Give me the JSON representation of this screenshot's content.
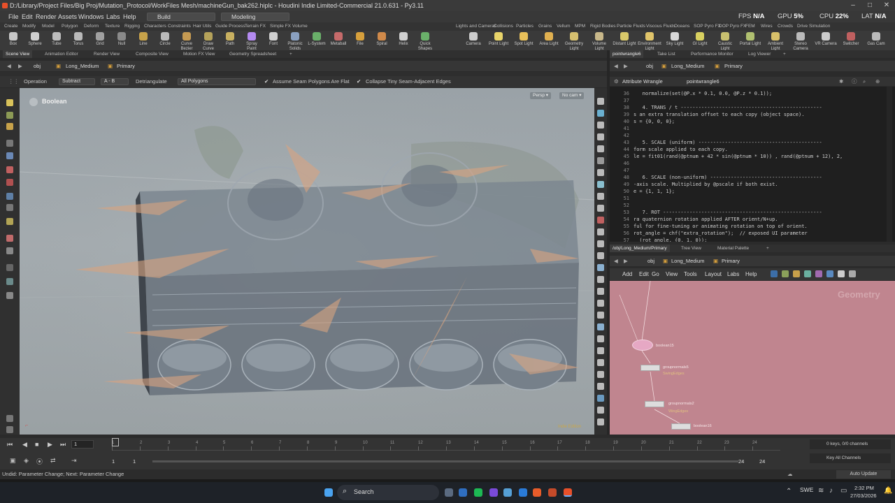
{
  "window": {
    "title": "D:/Library/Project Files/Big Proj/Mutation_Protocol/WorkFiles Mesh/machineGun_bak262.hiplc - Houdini Indie Limited-Commercial 21.0.631 - Py3.11"
  },
  "menubar": {
    "items": [
      "File",
      "Edit",
      "Render",
      "Assets",
      "Windows",
      "Labs",
      "Help"
    ],
    "desktop_build": "Build",
    "desktop_modeling": "Modeling",
    "fps_label": "FPS",
    "fps_value": "N/A",
    "gpu_label": "GPU",
    "gpu_value": "5%",
    "cpu_label": "CPU",
    "cpu_value": "22%",
    "lat_label": "LAT",
    "lat_value": "N/A"
  },
  "shelf": {
    "tabs_left": [
      "Create",
      "Modify",
      "Model",
      "Polygon",
      "Deform",
      "Texture",
      "Rigging",
      "Characters",
      "Constraints",
      "Hair Utils",
      "Guide Process",
      "Terrain FX",
      "Simple FX",
      "Volume"
    ],
    "tabs_right": [
      "Lights and Cameras",
      "Collisions",
      "Particles",
      "Grains",
      "Vellum",
      "MPM",
      "Rigid Bodies",
      "Particle Fluids",
      "Viscous Fluids",
      "Oceans",
      "SOP Pyro FX",
      "DOP Pyro FX",
      "FEM",
      "Wires",
      "Crowds",
      "Drive Simulation"
    ],
    "tools_left": [
      "Box",
      "Sphere",
      "Tube",
      "Torus",
      "Grid",
      "Null",
      "Line",
      "Circle",
      "Curve Bezier",
      "Draw Curve",
      "Path",
      "Spray Paint",
      "Font",
      "Platonic Solids",
      "L-System",
      "Metaball",
      "File",
      "Spiral",
      "Helix",
      "Quick Shapes"
    ],
    "tools_right": [
      "Camera",
      "Point Light",
      "Spot Light",
      "Area Light",
      "Geometry Light",
      "Volume Light",
      "Distant Light",
      "Environment Light",
      "Sky Light",
      "GI Light",
      "Caustic Light",
      "Portal Light",
      "Ambient Light",
      "Stereo Camera",
      "VR Camera",
      "Switcher",
      "Gas Cam"
    ]
  },
  "left_pane": {
    "tabs": [
      "Scene View",
      "Animation Editor",
      "Render View",
      "Composite View",
      "Motion FX View",
      "Geometry Spreadsheet"
    ],
    "path": [
      "obj",
      "Long_Medium",
      "Primary"
    ],
    "operation_label": "Operation",
    "operation_value": "Subtract",
    "ab_value": "A - B",
    "detriangulate_label": "Detriangulate",
    "detriangulate_value": "All Polygons",
    "assume_seam_label": "Assume Seam Polygons Are Flat",
    "collapse_label": "Collapse Tiny Seam-Adjacent Edges",
    "viewport_node": "Boolean",
    "persp_label": "Persp",
    "cam_label": "No cam",
    "scale_label": "Indie Edition"
  },
  "right_top": {
    "tabs": [
      "pointwrangle6",
      "Take List",
      "Performance Monitor",
      "Log Viewer"
    ],
    "path": [
      "obj",
      "Long_Medium",
      "Primary"
    ],
    "param_title": "Attribute Wrangle",
    "node_name": "pointwrangle6",
    "code_lines": [
      {
        "n": "36",
        "t": "   normalize(set(@P.x * 0.1, 0.0, @P.z * 0.1));"
      },
      {
        "n": "37",
        "t": ""
      },
      {
        "n": "38",
        "t": "   4. TRANS / t ------------------------------------------------"
      },
      {
        "n": "39",
        "t": "s an extra translation offset to each copy (object space)."
      },
      {
        "n": "40",
        "t": "s = {0, 0, 0};"
      },
      {
        "n": "41",
        "t": ""
      },
      {
        "n": "42",
        "t": ""
      },
      {
        "n": "43",
        "t": "   5. SCALE (uniform) ------------------------------------------"
      },
      {
        "n": "44",
        "t": "form scale applied to each copy."
      },
      {
        "n": "45",
        "t": "le = fit01(rand(@ptnum + 42 * sin(@ptnum * 10)) , rand(@ptnum + 12), 2,"
      },
      {
        "n": "46",
        "t": ""
      },
      {
        "n": "47",
        "t": ""
      },
      {
        "n": "48",
        "t": "   6. SCALE (non-uniform) --------------------------------------"
      },
      {
        "n": "49",
        "t": "-axis scale. Multiplied by @pscale if both exist."
      },
      {
        "n": "50",
        "t": "e = {1, 1, 1};"
      },
      {
        "n": "51",
        "t": ""
      },
      {
        "n": "52",
        "t": ""
      },
      {
        "n": "53",
        "t": "   7. ROT ------------------------------------------------------"
      },
      {
        "n": "54",
        "t": "ra quaternion rotation applied AFTER orient/N+up."
      },
      {
        "n": "55",
        "t": "ful for fine-tuning or animating rotation on top of orient."
      },
      {
        "n": "56",
        "t": "rot_angle = chf(\"extra_rotation\");  // exposed UI parameter"
      },
      {
        "n": "57",
        "t": "  (rot_angle, {0, 1, 0});"
      }
    ]
  },
  "right_bottom": {
    "tabs": [
      "/obj/Long_Medium/Primary",
      "Tree View",
      "Material Palette"
    ],
    "path": [
      "obj",
      "Long_Medium",
      "Primary"
    ],
    "menu": [
      "Add",
      "Edit",
      "Go",
      "View",
      "Tools",
      "Layout",
      "Labs",
      "Help"
    ],
    "context_label": "Geometry",
    "nodes": [
      "boolean15",
      "groupnormals5",
      "groupnormals2",
      "boolean16"
    ],
    "node_sublabels": [
      "",
      "SwingEdges",
      "",
      "WingEdges"
    ]
  },
  "timeline": {
    "current_frame": "1",
    "ticks": [
      "1",
      "2",
      "3",
      "4",
      "5",
      "6",
      "7",
      "8",
      "9",
      "10",
      "11",
      "12",
      "13",
      "14",
      "15",
      "16",
      "17",
      "18",
      "19",
      "20",
      "21",
      "22",
      "23",
      "24"
    ],
    "start_frame": "1",
    "start_frame2": "1",
    "end_frame": "24",
    "end_frame2": "24",
    "keys_label": "0 keys, 0/0 channels",
    "key_all_label": "Key All Channels",
    "auto_update": "Auto Update"
  },
  "status": {
    "text": "Undid: Parameter Change; Next: Parameter Change"
  },
  "taskbar": {
    "search_placeholder": "Search",
    "language": "SWE",
    "time": "2:32 PM",
    "date": "27/03/2026"
  }
}
